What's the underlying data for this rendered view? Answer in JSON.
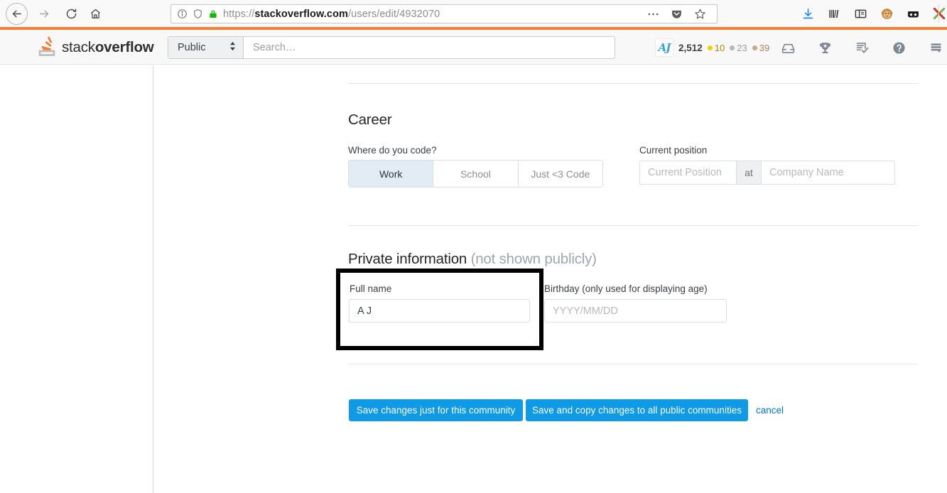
{
  "browser": {
    "url_prefix": "https://",
    "url_domain": "stackoverflow.com",
    "url_path": "/users/edit/4932070",
    "icons": {
      "back": "back-arrow-icon",
      "forward": "forward-arrow-icon",
      "reload": "reload-icon",
      "home": "home-icon",
      "page_info": "info-icon",
      "tracking_protection": "shield-icon",
      "lock": "padlock-icon",
      "page_actions": "ellipsis-icon",
      "pocket": "pocket-icon",
      "bookmark": "star-icon",
      "downloads": "download-icon",
      "library": "library-icon",
      "sidebar": "sidebar-icon",
      "monkey": "greasemonkey-icon",
      "glasses": "glasses-icon",
      "adblock": "adblock-x-icon"
    }
  },
  "site_header": {
    "logo_light": "stack",
    "logo_bold": "overflow",
    "scope": "Public",
    "search_placeholder": "Search…",
    "user": {
      "avatar_initials": "AJ",
      "reputation": "2,512",
      "gold": "10",
      "silver": "23",
      "bronze": "39"
    },
    "icons": [
      "inbox-icon",
      "trophy-icon",
      "review-icon",
      "help-icon",
      "site-switcher-icon"
    ],
    "accent_color": "#ef8236"
  },
  "career": {
    "heading": "Career",
    "where_label": "Where do you code?",
    "options": [
      {
        "label": "Work",
        "selected": true
      },
      {
        "label": "School",
        "selected": false
      },
      {
        "label": "Just <3 Code",
        "selected": false
      }
    ],
    "position_label": "Current position",
    "position_placeholder": "Current Position",
    "at_label": "at",
    "company_placeholder": "Company Name"
  },
  "private": {
    "heading": "Private information",
    "heading_note": "(not shown publicly)",
    "full_name_label": "Full name",
    "full_name_value": "A J",
    "birthday_label": "Birthday (only used for displaying age)",
    "birthday_placeholder": "YYYY/MM/DD"
  },
  "actions": {
    "save_community": "Save changes just for this community",
    "save_all": "Save and copy changes to all public communities",
    "cancel": "cancel",
    "primary_color": "#0f9ae5",
    "link_color": "#0077cc"
  },
  "annotation": {
    "highlight_color": "#000000",
    "target": "full-name-field"
  }
}
